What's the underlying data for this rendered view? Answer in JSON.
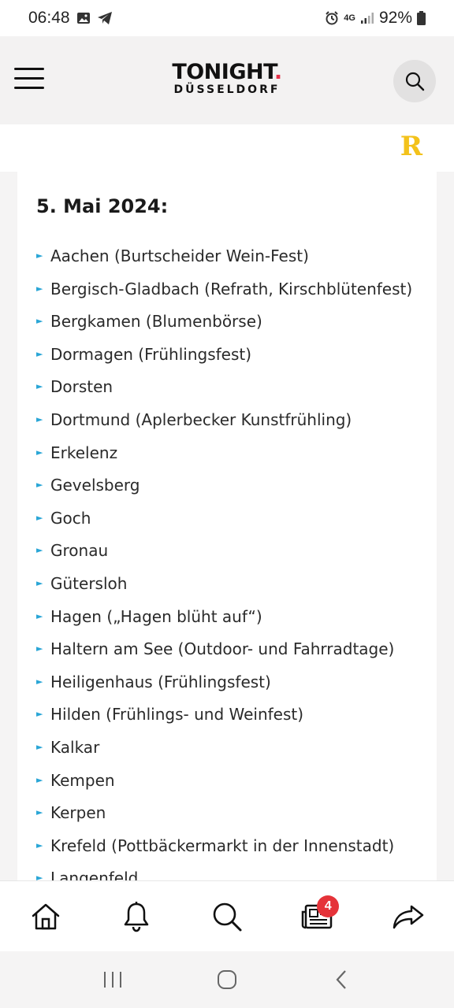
{
  "status": {
    "time": "06:48",
    "network": "4G",
    "battery": "92%"
  },
  "header": {
    "logo_main": "TONIGHT",
    "logo_dot": ".",
    "logo_sub": "DÜSSELDORF"
  },
  "ad": {
    "glyph": "R"
  },
  "content": {
    "date_heading": "5. Mai 2024:",
    "items": [
      "Aachen (Burtscheider Wein-Fest)",
      "Bergisch-Gladbach (Refrath, Kirschblütenfest)",
      "Bergkamen (Blumenbörse)",
      "Dormagen (Frühlingsfest)",
      "Dorsten",
      "Dortmund (Aplerbecker Kunstfrühling)",
      "Erkelenz",
      "Gevelsberg",
      "Goch",
      "Gronau",
      "Gütersloh",
      "Hagen („Hagen blüht auf“)",
      "Haltern am See (Outdoor- und Fahrradtage)",
      "Heiligenhaus (Frühlingsfest)",
      "Hilden (Frühlings- und Weinfest)",
      "Kalkar",
      "Kempen",
      "Kerpen",
      "Krefeld (Pottbäckermarkt in der Innenstadt)",
      "Langenfeld"
    ]
  },
  "bottom_nav": {
    "news_badge": "4"
  },
  "colors": {
    "accent_bullet": "#2aa6d6",
    "badge_red": "#e53339",
    "ad_yellow": "#f3c21b"
  }
}
